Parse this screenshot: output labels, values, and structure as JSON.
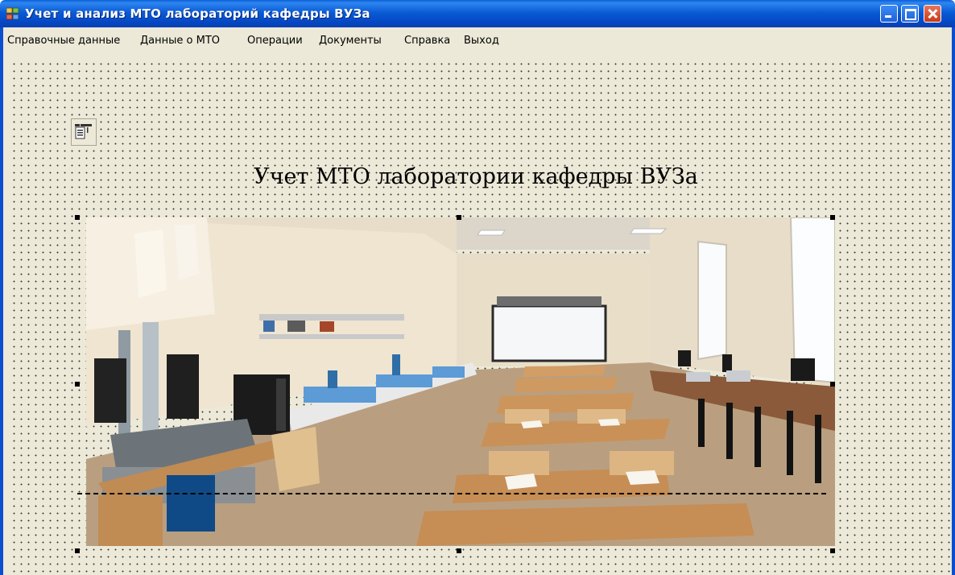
{
  "window": {
    "title": "Учет и анализ МТО лабораторий кафедры ВУЗа",
    "buttons": {
      "minimize": "minimize",
      "maximize": "maximize",
      "close": "close"
    }
  },
  "menu": [
    {
      "label": "Справочные данные"
    },
    {
      "label": "Данные о МТО"
    },
    {
      "label": "Операции"
    },
    {
      "label": "Документы"
    },
    {
      "label": "Справка"
    },
    {
      "label": "Выход"
    }
  ],
  "form": {
    "heading": "Учет МТО лаборатории кафедры ВУЗа",
    "toolbar_icon": "menu-editor-icon",
    "photo_subject": ""
  },
  "colors": {
    "titlebar": "#0a5bd6",
    "menubar": "#ece9d8",
    "close_button": "#c63a1c"
  }
}
